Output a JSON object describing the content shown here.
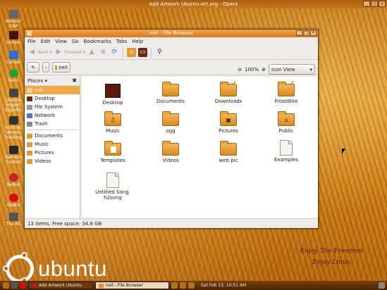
{
  "top_window_title": "Add Artwork Ubuntu-Art.org - Opera",
  "desktop_icons": [
    {
      "label": "Nebour GRP",
      "icon": "computer-icon",
      "color": "#6a6a6a"
    },
    {
      "label": "Compu",
      "icon": "computer-icon",
      "color": "#3a3a3a"
    },
    {
      "label": "Conver",
      "icon": "converter-icon",
      "color": "#2a6fd0"
    },
    {
      "label": "Ferin",
      "icon": "play-icon",
      "color": "#2aa02a"
    },
    {
      "label": "Gnome Import Exports",
      "icon": "import-icon",
      "color": "#444"
    },
    {
      "label": "Internet Version Tracking",
      "icon": "tracker-icon",
      "color": "#333"
    },
    {
      "label": "Remote Control",
      "icon": "remote-icon",
      "color": "#2a2a2a"
    },
    {
      "label": "Nebus",
      "icon": "disk-icon",
      "color": "#cc2222"
    },
    {
      "label": "Opera",
      "icon": "opera-icon",
      "color": "#d41010"
    },
    {
      "label": "The Rh",
      "icon": "printer-icon",
      "color": "#555"
    }
  ],
  "window": {
    "title": "neil - File Browser",
    "menu": [
      "File",
      "Edit",
      "View",
      "Go",
      "Bookmarks",
      "Tabs",
      "Help"
    ],
    "toolbar": {
      "back": "Back",
      "forward": "Forward"
    },
    "location_button": "neil",
    "zoom_level": "100%",
    "view_mode": "Icon View",
    "sidebar_header": "Places",
    "places": [
      {
        "label": "neil",
        "icon": "home-folder-icon",
        "selected": true
      },
      {
        "label": "Desktop",
        "icon": "desktop-icon",
        "selected": false
      },
      {
        "label": "File System",
        "icon": "filesystem-icon",
        "selected": false
      },
      {
        "label": "Network",
        "icon": "network-icon",
        "selected": false
      },
      {
        "label": "Trash",
        "icon": "trash-icon",
        "selected": false
      }
    ],
    "bookmarks": [
      "Documents",
      "Music",
      "Pictures",
      "Videos"
    ],
    "files": [
      {
        "label": "Desktop",
        "kind": "desktop"
      },
      {
        "label": "Documents",
        "kind": "folder"
      },
      {
        "label": "Downloads",
        "kind": "folder-arrow"
      },
      {
        "label": "FrostWire",
        "kind": "folder-arrow"
      },
      {
        "label": "Music",
        "kind": "folder-music"
      },
      {
        "label": "ogg",
        "kind": "folder"
      },
      {
        "label": "Pictures",
        "kind": "folder-pictures"
      },
      {
        "label": "Public",
        "kind": "folder-public"
      },
      {
        "label": "Templates",
        "kind": "folder-templates"
      },
      {
        "label": "Videos",
        "kind": "folder"
      },
      {
        "label": "web pic",
        "kind": "folder"
      },
      {
        "label": "Examples",
        "kind": "file"
      },
      {
        "label": "Untitled Song.\nh2song",
        "kind": "song"
      }
    ],
    "status": "13 items, Free space: 34.8 GB"
  },
  "branding": {
    "logo_text": "ubuntu",
    "slogan_line1": "Enjoy The Freedom",
    "slogan_line2": "Enjoy Linux"
  },
  "taskbar": {
    "tasks": [
      "Add Artwork Ubuntu",
      "neil - File Browser"
    ],
    "clock": "Sat Feb 13, 10:51 AM"
  },
  "colors": {
    "accent": "#f0a848",
    "title_orange": "#d97a1c",
    "logo_dot": "#e05a10"
  }
}
